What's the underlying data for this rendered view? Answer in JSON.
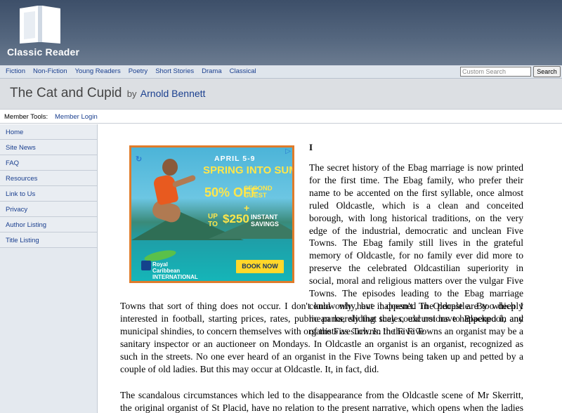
{
  "brand": {
    "name": "Classic Reader"
  },
  "nav": {
    "links": [
      "Fiction",
      "Non-Fiction",
      "Young Readers",
      "Poetry",
      "Short Stories",
      "Drama",
      "Classical"
    ],
    "search_placeholder": "Custom Search",
    "search_button": "Search"
  },
  "book": {
    "title": "The Cat and Cupid",
    "by": "by",
    "author": "Arnold Bennett"
  },
  "member": {
    "label": "Member Tools:",
    "login": "Member Login"
  },
  "sidebar": {
    "items": [
      "Home",
      "Site News",
      "FAQ",
      "Resources",
      "Link to Us",
      "Privacy",
      "Author Listing",
      "Title Listing"
    ]
  },
  "ad": {
    "dates": "APRIL 5-9",
    "headline": "SPRING INTO SUMMER",
    "offer1_big": "50% OFF",
    "offer1_small": "SECOND GUEST",
    "plus": "+",
    "offer2_up": "UP TO",
    "offer2_amount": "$250",
    "offer2_small": "INSTANT SAVINGS",
    "brand": "Royal Caribbean INTERNATIONAL",
    "cta": "BOOK NOW"
  },
  "article": {
    "chapter": "I",
    "para1_right": "The secret history of the Ebag marriage is now printed for the first time. The Ebag family, who prefer their name to be accented on the first syllable, once almost ruled Oldcastle, which is a clean and conceited borough, with long historical traditions, on the very edge of the industrial, democratic and unclean Five Towns. The Ebag family still lives in the grateful memory of Oldcastle, for no family ever did more to preserve the celebrated Oldcastilian superiority in social, moral and religious matters over the vulgar Five Towns. The episodes leading to the Ebag marriage could only have happened in Oldcastle. By which I mean merely that they could not have happened in any of the Five Towns. In the Five",
    "para1_full": "Towns that sort of thing does not occur. I don't know why, but it doesn't. The people are too deeply interested in football, starting prices, rates, public parks, sliding scales, excursions to Blackpool, and municipal shindies, to concern themselves with organists as such. In the Five Towns an organist may be a sanitary inspector or an auctioneer on Mondays. In Oldcastle an organist is an organist, recognized as such in the streets. No one ever heard of an organist in the Five Towns being taken up and petted by a couple of old ladies. But this may occur at Oldcastle. It, in fact, did.",
    "para2": "The scandalous circumstances which led to the disappearance from the Oldcastle scene of Mr Skerritt, the original organist of St Placid, have no relation to the present narrative, which opens when the ladies Ebag"
  }
}
